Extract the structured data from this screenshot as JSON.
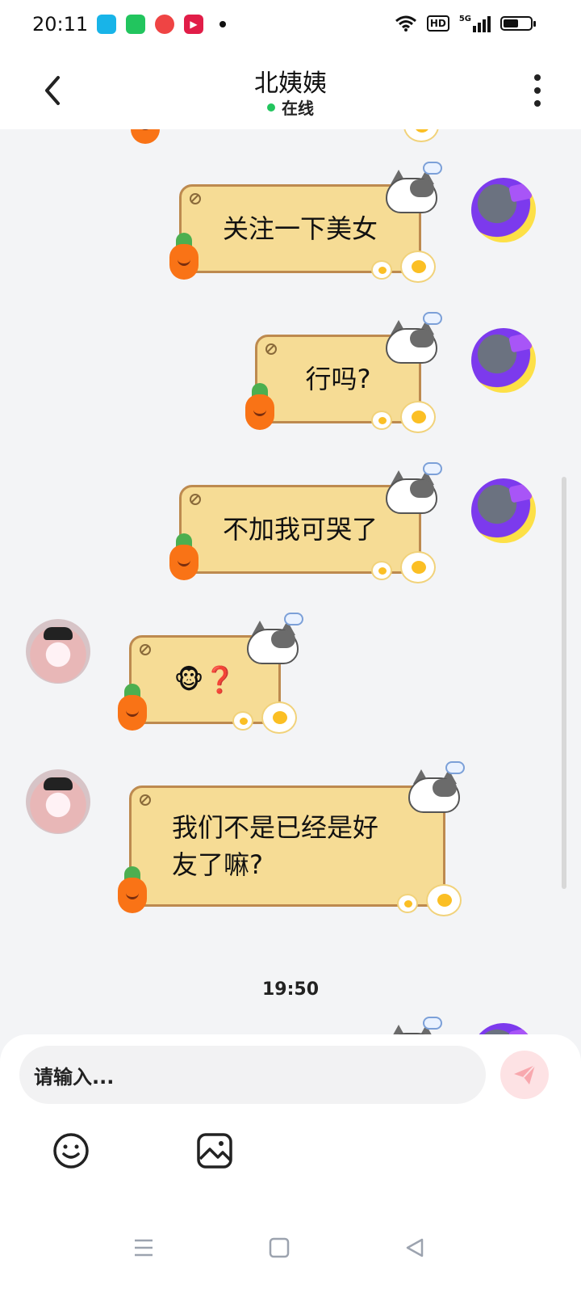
{
  "status_bar": {
    "time": "20:11",
    "hd_label": "HD",
    "network_label": "5G",
    "icons": [
      "wifi-icon",
      "hd-icon",
      "5g-signal-icon",
      "battery-icon"
    ],
    "apps": [
      "app-icon-1",
      "app-icon-2",
      "app-icon-3",
      "app-icon-4"
    ],
    "battery_level": 0.55
  },
  "header": {
    "title": "北姨姨",
    "status": "在线",
    "status_color": "#22c55e"
  },
  "messages": [
    {
      "side": "me",
      "text": "关注一下美女"
    },
    {
      "side": "me",
      "text": "行吗?"
    },
    {
      "side": "me",
      "text": "不加我可哭了"
    },
    {
      "side": "other",
      "text": "🐵❓"
    },
    {
      "side": "other",
      "text": "我们不是已经是好友了嘛?"
    }
  ],
  "timestamp": "19:50",
  "composer": {
    "placeholder": "请输入...",
    "send_color": "#f8a8ae",
    "tools": [
      "emoji-icon",
      "image-icon"
    ]
  },
  "nav_bar": [
    "menu-icon",
    "home-icon",
    "back-icon"
  ],
  "colors": {
    "bubble": "#f6dc95",
    "bubble_border": "#bd8a4f",
    "background": "#f3f4f6"
  }
}
